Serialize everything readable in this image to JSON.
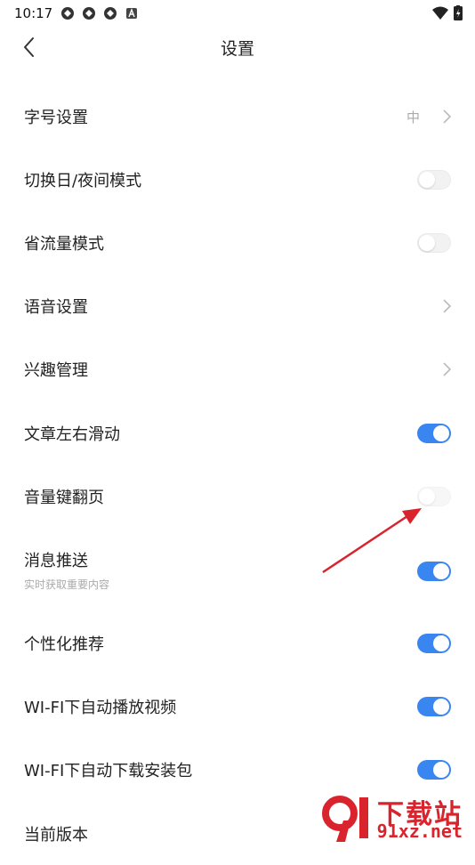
{
  "status_bar": {
    "time": "10:17",
    "icons": [
      "sync-icon",
      "sync-icon",
      "sync-icon",
      "a-badge-icon"
    ],
    "right_icons": [
      "wifi-icon",
      "battery-icon"
    ]
  },
  "header": {
    "title": "设置"
  },
  "settings": [
    {
      "label": "字号设置",
      "type": "link",
      "value": "中"
    },
    {
      "label": "切换日/夜间模式",
      "type": "toggle",
      "on": false
    },
    {
      "label": "省流量模式",
      "type": "toggle",
      "on": false
    },
    {
      "label": "语音设置",
      "type": "link"
    },
    {
      "label": "兴趣管理",
      "type": "link"
    },
    {
      "label": "文章左右滑动",
      "type": "toggle",
      "on": true
    },
    {
      "label": "音量键翻页",
      "type": "toggle",
      "on": false
    },
    {
      "label": "消息推送",
      "sub": "实时获取重要内容",
      "type": "toggle",
      "on": true
    },
    {
      "label": "个性化推荐",
      "type": "toggle",
      "on": true
    },
    {
      "label": "WI-FI下自动播放视频",
      "type": "toggle",
      "on": true
    },
    {
      "label": "WI-FI下自动下载安装包",
      "type": "toggle",
      "on": true
    },
    {
      "label": "当前版本",
      "type": "info"
    }
  ],
  "colors": {
    "accent": "#3a86f0",
    "annotation": "#d9232d"
  },
  "watermark": {
    "line1": "下载站",
    "line2": "91xz.net"
  }
}
